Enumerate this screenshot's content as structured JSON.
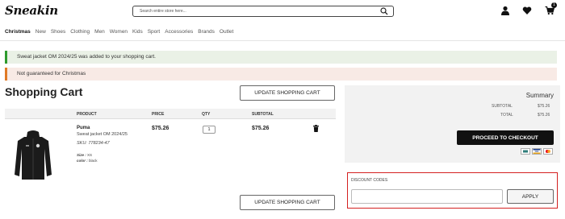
{
  "header": {
    "logo_text": "Sneakin",
    "search": {
      "placeholder": "Search entire store here..."
    },
    "cart_count": "1",
    "icons": [
      "search-icon",
      "user-icon",
      "heart-icon",
      "cart-icon"
    ]
  },
  "nav": {
    "items": [
      "Christmas",
      "New",
      "Shoes",
      "Clothing",
      "Men",
      "Women",
      "Kids",
      "Sport",
      "Accessories",
      "Brands",
      "Outlet"
    ]
  },
  "messages": {
    "success": "Sweat jacket OM 2024/25 was added to your shopping cart.",
    "warning": "Not guaranteed for Christmas"
  },
  "cart": {
    "title": "Shopping Cart",
    "update_label": "UPDATE SHOPPING CART",
    "columns": [
      "PRODUCT",
      "PRICE",
      "QTY",
      "SUBTOTAL"
    ],
    "item": {
      "brand": "Puma",
      "name": "Sweat jacket OM 2024/25",
      "sku": "SKU: 778234-47",
      "size_label": "Size :",
      "size_value": "XS",
      "color_label": "color :",
      "color_value": "black",
      "price": "$75.26",
      "qty": "1",
      "subtotal": "$75.26"
    }
  },
  "summary": {
    "title": "Summary",
    "subtotal_label": "SUBTOTAL",
    "subtotal_value": "$75.26",
    "total_label": "TOTAL",
    "total_value": "$75.26",
    "checkout_label": "PROCEED TO CHECKOUT",
    "payment_icons": [
      "bank-card-icon",
      "visa-icon",
      "mastercard-icon"
    ]
  },
  "discount": {
    "title": "DISCOUNT CODES",
    "input_value": "",
    "apply_label": "APPLY"
  },
  "colors": {
    "accent": "#111111",
    "success_bar": "#2e9a2e",
    "warning_bar": "#e07a25",
    "highlight_border": "#d42020"
  }
}
